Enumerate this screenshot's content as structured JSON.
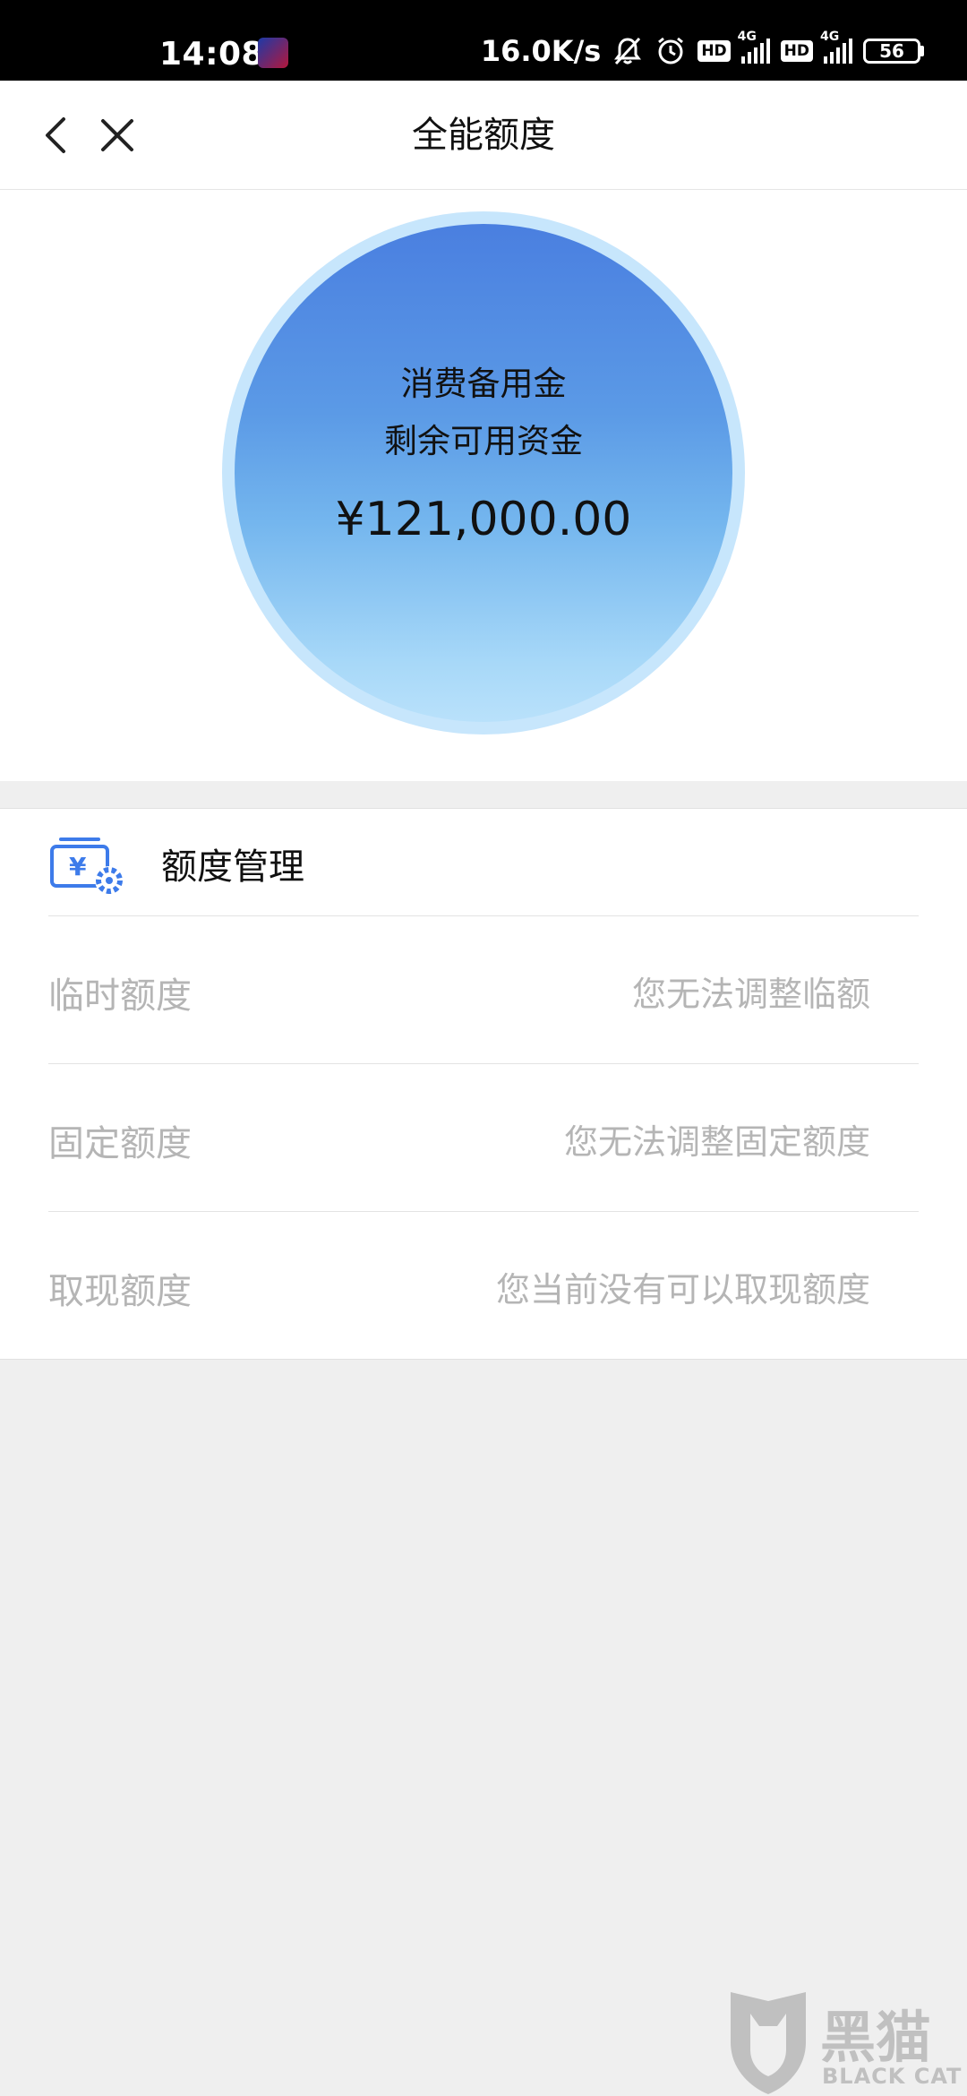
{
  "status_bar": {
    "time": "14:08",
    "network_speed": "16.0K/s",
    "hd1": "HD",
    "net1": "4G",
    "hd2": "HD",
    "net2": "4G",
    "battery": "56"
  },
  "header": {
    "title": "全能额度"
  },
  "hero": {
    "line1": "消费备用金",
    "line2": "剩余可用资金",
    "amount": "¥121,000.00"
  },
  "management": {
    "title": "额度管理",
    "rows": [
      {
        "label": "临时额度",
        "value": "您无法调整临额"
      },
      {
        "label": "固定额度",
        "value": "您无法调整固定额度"
      },
      {
        "label": "取现额度",
        "value": "您当前没有可以取现额度"
      }
    ]
  },
  "watermark": {
    "cn": "黑猫",
    "en": "BLACK CAT"
  },
  "colors": {
    "circle_top": "#4a7fe0",
    "circle_bottom": "#b9e1fb",
    "circle_ring": "#c7e6fc",
    "icon_blue": "#3d7bea",
    "muted_text": "#b5b5b5",
    "background": "#efefef"
  }
}
